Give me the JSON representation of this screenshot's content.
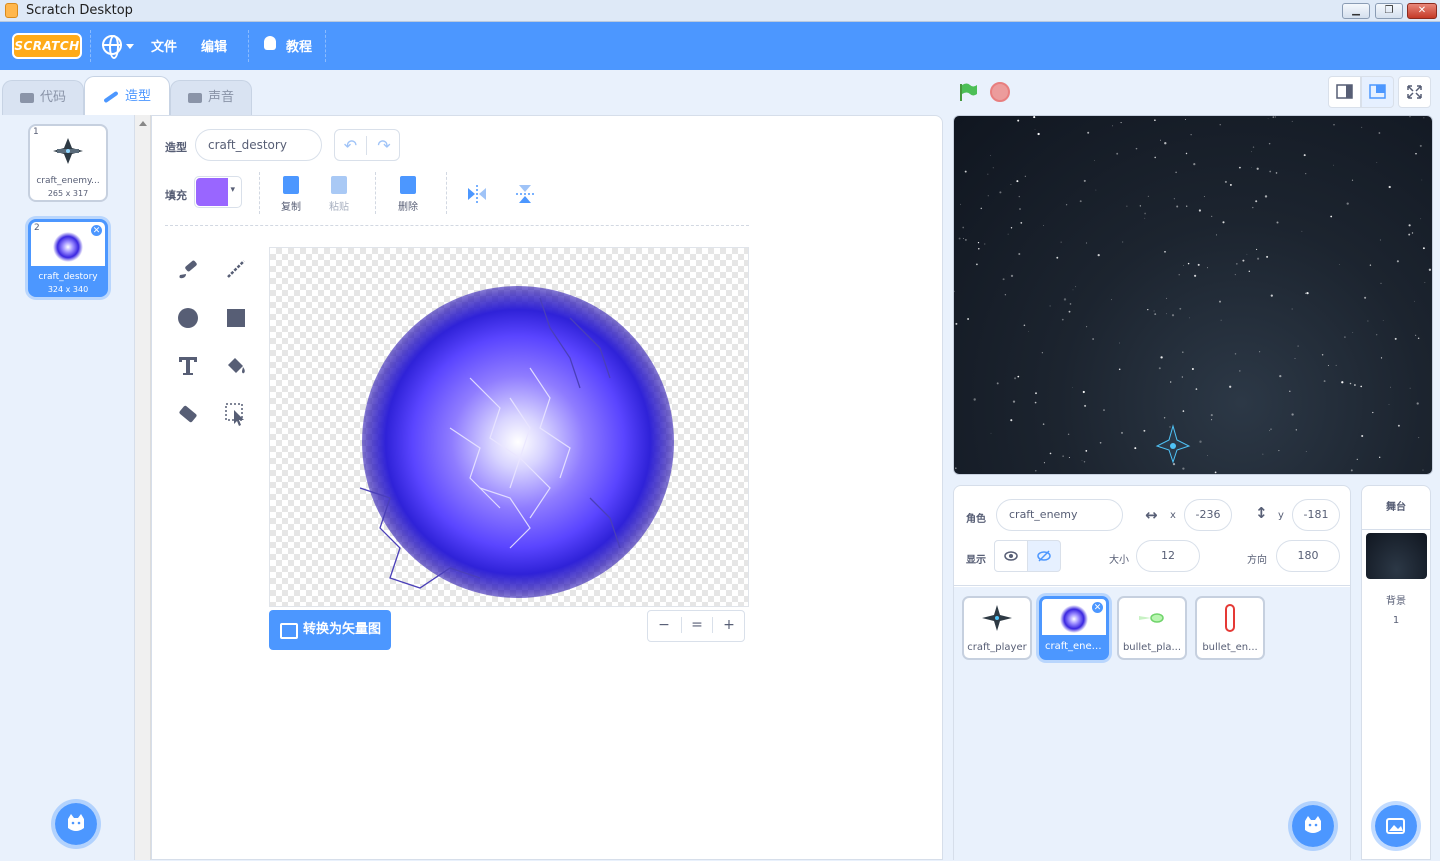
{
  "window": {
    "title": "Scratch Desktop",
    "min": "▁",
    "max": "❐",
    "close": "✕"
  },
  "menu": {
    "logo": "SCRATCH",
    "file": "文件",
    "edit": "编辑",
    "tutorials": "教程"
  },
  "tabs": {
    "code": "代码",
    "costumes": "造型",
    "sounds": "声音"
  },
  "costumes": [
    {
      "num": "1",
      "name": "craft_enemy...",
      "size": "265 x 317"
    },
    {
      "num": "2",
      "name": "craft_destory",
      "size": "324 x 340"
    }
  ],
  "paint": {
    "costume_label": "造型",
    "costume_name": "craft_destory",
    "fill_label": "填充",
    "fill_color": "#9966ff",
    "copy": "复制",
    "paste": "粘贴",
    "delete": "删除",
    "convert": "转换为矢量图",
    "zoom_out": "−",
    "zoom_reset": "=",
    "zoom_in": "+"
  },
  "sprite_info": {
    "sprite_label": "角色",
    "sprite_name": "craft_enemy",
    "x_label": "x",
    "x": "-236",
    "y_label": "y",
    "y": "-181",
    "show_label": "显示",
    "size_label": "大小",
    "size": "12",
    "direction_label": "方向",
    "direction": "180"
  },
  "sprites": [
    {
      "name": "craft_player"
    },
    {
      "name": "craft_enemy"
    },
    {
      "name": "bullet_pla..."
    },
    {
      "name": "bullet_en..."
    }
  ],
  "stage_panel": {
    "title": "舞台",
    "backdrops_label": "背景",
    "backdrops_count": "1"
  },
  "colors": {
    "accent": "#4c97ff",
    "menubar": "#4c97ff",
    "logo": "#ffab19",
    "flag": "#4cbf56",
    "stop": "#ec9c9c"
  }
}
